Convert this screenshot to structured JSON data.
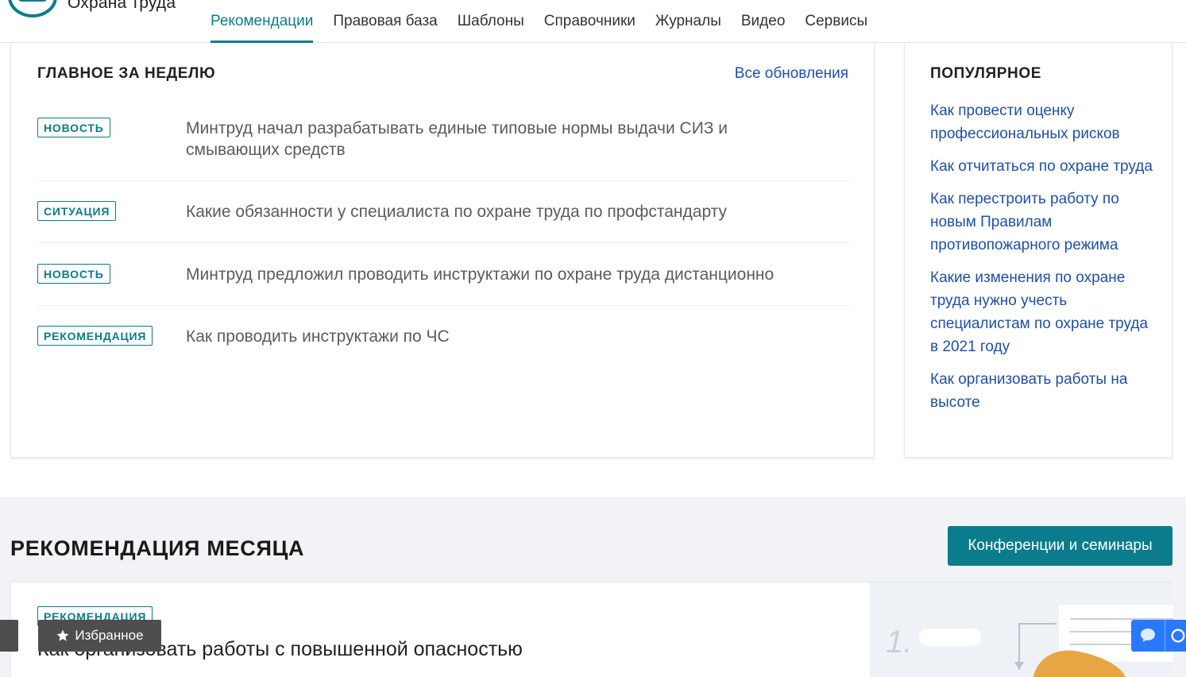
{
  "header": {
    "site_name": "Охрана труда",
    "nav": [
      {
        "label": "Рекомендации",
        "active": true
      },
      {
        "label": "Правовая база"
      },
      {
        "label": "Шаблоны"
      },
      {
        "label": "Справочники"
      },
      {
        "label": "Журналы"
      },
      {
        "label": "Видео"
      },
      {
        "label": "Сервисы"
      }
    ]
  },
  "week": {
    "title": "ГЛАВНОЕ ЗА НЕДЕЛЮ",
    "all_updates": "Все обновления",
    "items": [
      {
        "badge": "НОВОСТЬ",
        "text": "Минтруд начал разрабатывать единые типовые нормы выдачи СИЗ и смывающих средств"
      },
      {
        "badge": "СИТУАЦИЯ",
        "text": "Какие обязанности у специалиста по охране труда по профстандарту"
      },
      {
        "badge": "НОВОСТЬ",
        "text": "Минтруд предложил проводить инструктажи по охране труда дистанционно"
      },
      {
        "badge": "РЕКОМЕНДАЦИЯ",
        "text": "Как проводить инструктажи по ЧС"
      }
    ]
  },
  "popular": {
    "title": "ПОПУЛЯРНОЕ",
    "items": [
      "Как провести оценку профессиональных рисков",
      "Как отчитаться по охране труда",
      "Как перестроить работу по новым Правилам противопожарного режима",
      "Какие изменения по охране труда нужно учесть специалистам по охране труда в 2021 году",
      "Как организовать работы на высоте"
    ]
  },
  "month": {
    "title": "РЕКОМЕНДАЦИЯ МЕСЯЦА",
    "conference_button": "Конференции и семинары",
    "badge": "РЕКОМЕНДАЦИЯ",
    "headline": "Как организовать работы с повышенной опасностью",
    "illustration_step": "1."
  },
  "floating": {
    "favorites": "Избранное",
    "favorites_icon": "star-icon",
    "chat_icon": "chat-bubble-icon"
  },
  "colors": {
    "accent": "#0a7c8c",
    "link": "#1f4fa8",
    "section_bg": "#f2f3f6",
    "chat": "#2979ff"
  }
}
